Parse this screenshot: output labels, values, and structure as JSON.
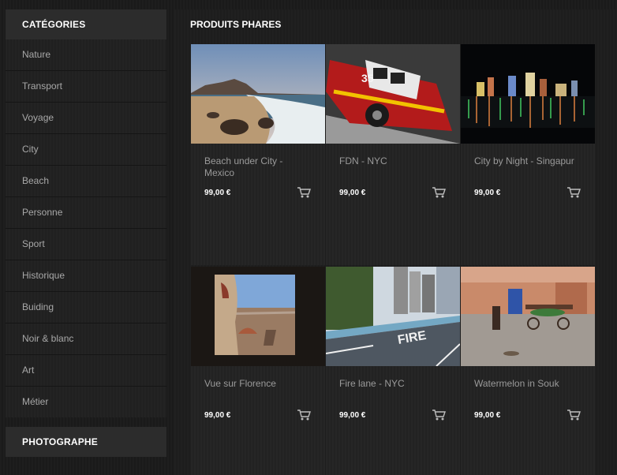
{
  "sidebar": {
    "categories_title": "CATÉGORIES",
    "items": [
      {
        "label": "Nature"
      },
      {
        "label": "Transport"
      },
      {
        "label": "Voyage"
      },
      {
        "label": "City"
      },
      {
        "label": "Beach"
      },
      {
        "label": "Personne"
      },
      {
        "label": "Sport"
      },
      {
        "label": "Historique"
      },
      {
        "label": "Buiding"
      },
      {
        "label": "Noir & blanc"
      },
      {
        "label": "Art"
      },
      {
        "label": "Métier"
      }
    ],
    "photographer_title": "PHOTOGRAPHE"
  },
  "main": {
    "title": "PRODUITS PHARES",
    "products": [
      {
        "name": "Beach under City - Mexico",
        "price": "99,00 €"
      },
      {
        "name": "FDN - NYC",
        "price": "99,00 €"
      },
      {
        "name": "City by Night - Singapur",
        "price": "99,00 €"
      },
      {
        "name": "Vue sur Florence",
        "price": "99,00 €"
      },
      {
        "name": "Fire lane - NYC",
        "price": "99,00 €"
      },
      {
        "name": "Watermelon in Souk",
        "price": "99,00 €"
      }
    ]
  },
  "colors": {
    "background": "#1c1c1c",
    "header_bg": "#2c2c2c",
    "text_muted": "#a8a8a8",
    "text_white": "#ffffff"
  },
  "icons": {
    "cart": "shopping-cart-icon"
  }
}
